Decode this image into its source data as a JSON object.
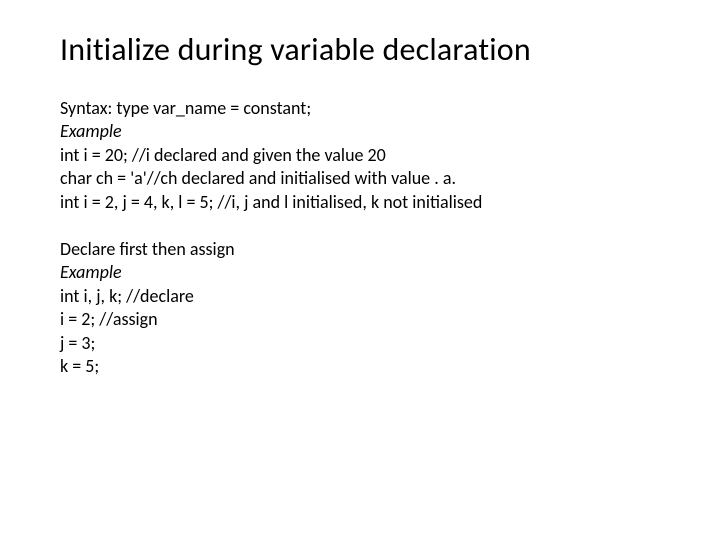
{
  "title": "Initialize during variable declaration",
  "block1": {
    "line1": "Syntax: type var_name = constant;",
    "line2": "Example",
    "line3": "int i = 20; //i declared and given the value 20",
    "line4": "char ch = 'a'//ch declared and initialised with value . a.",
    "line5": "int i = 2, j = 4, k, l = 5; //i, j and l initialised, k not initialised"
  },
  "block2": {
    "line1": "Declare first then assign",
    "line2": "Example",
    "line3": "int i, j, k; //declare",
    "line4": "i = 2; //assign",
    "line5": "j = 3;",
    "line6": "k = 5;"
  }
}
